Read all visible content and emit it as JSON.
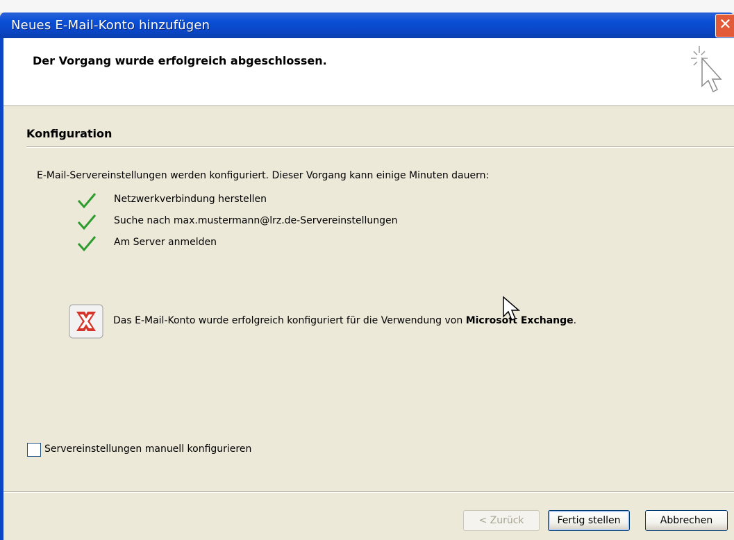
{
  "window": {
    "title": "Neues E-Mail-Konto hinzufügen",
    "close_glyph": "✕"
  },
  "header": {
    "text": "Der Vorgang wurde erfolgreich abgeschlossen.",
    "icon": "wizard-cursor-icon"
  },
  "configuration": {
    "section_title": "Konfiguration",
    "intro": "E-Mail-Servereinstellungen werden konfiguriert. Dieser Vorgang kann einige Minuten dauern:",
    "steps": [
      {
        "label": "Netzwerkverbindung herstellen",
        "status": "done"
      },
      {
        "label": "Suche nach max.mustermann@lrz.de-Servereinstellungen",
        "status": "done"
      },
      {
        "label": "Am Server anmelden",
        "status": "done"
      }
    ],
    "check_color": "#2e9b2e",
    "result": {
      "icon": "exchange-icon",
      "text": "Das E-Mail-Konto wurde erfolgreich konfiguriert für die Verwendung von ",
      "product": "Microsoft Exchange",
      "suffix": "."
    }
  },
  "manual": {
    "label": "Servereinstellungen manuell konfigurieren",
    "checked": false
  },
  "buttons": {
    "back": "< Zurück",
    "finish": "Fertig stellen",
    "cancel": "Abbrechen"
  },
  "colors": {
    "titlebar": "#0a4fd6",
    "dialog_bg": "#ece9d8",
    "close_button": "#e35a38",
    "exchange_red": "#d6352b"
  }
}
